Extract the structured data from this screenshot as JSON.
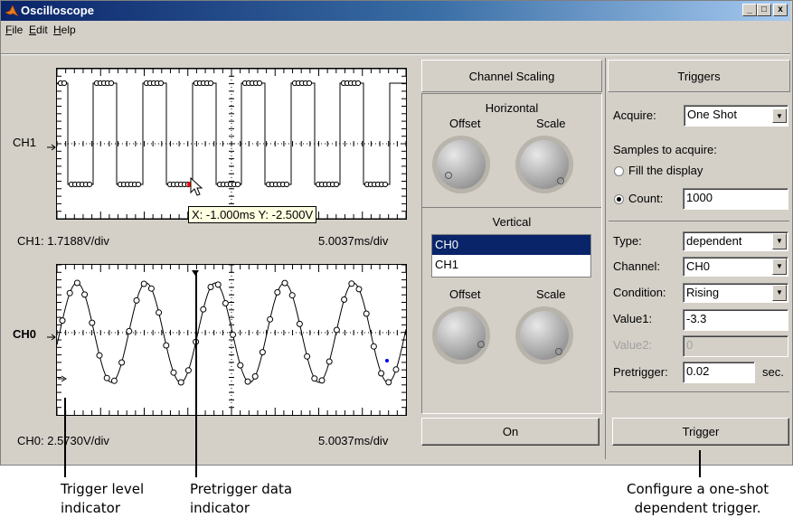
{
  "window": {
    "title": "Oscilloscope",
    "controls": [
      "_",
      "□",
      "x"
    ]
  },
  "menu": [
    {
      "label": "File",
      "accel": "F",
      "rest": "ile"
    },
    {
      "label": "Edit",
      "accel": "E",
      "rest": "dit"
    },
    {
      "label": "Help",
      "accel": "H",
      "rest": "elp"
    }
  ],
  "scope": {
    "top": {
      "channel_label": "CH1",
      "scale_left": "CH1: 1.7188V/div",
      "scale_right": "5.0037ms/div",
      "tooltip": "X: -1.000ms Y: -2.500V"
    },
    "bottom": {
      "channel_label": "CH0",
      "scale_left": "CH0: 2.5730V/div",
      "scale_right": "5.0037ms/div"
    }
  },
  "channel_scaling": {
    "header": "Channel Scaling",
    "horizontal_label": "Horizontal",
    "offset_label": "Offset",
    "scale_label": "Scale",
    "vertical_label": "Vertical",
    "channels": [
      "CH0",
      "CH1"
    ],
    "selected_channel": "CH0",
    "vertical_offset_label": "Offset",
    "vertical_scale_label": "Scale",
    "on_button": "On"
  },
  "triggers": {
    "header": "Triggers",
    "acquire_label": "Acquire:",
    "acquire_value": "One Shot",
    "samples_label": "Samples to acquire:",
    "fill_label": "Fill the display",
    "count_label": "Count:",
    "count_value": "1000",
    "type_label": "Type:",
    "type_value": "dependent",
    "channel_label": "Channel:",
    "channel_value": "CH0",
    "condition_label": "Condition:",
    "condition_value": "Rising",
    "value1_label": "Value1:",
    "value1_value": "-3.3",
    "value2_label": "Value2:",
    "value2_value": "0",
    "pretrigger_label": "Pretrigger:",
    "pretrigger_value": "0.02",
    "pretrigger_unit": "sec.",
    "trigger_button": "Trigger"
  },
  "annotations": {
    "trigger_level": [
      "Trigger level",
      "indicator"
    ],
    "pretrigger": [
      "Pretrigger data",
      "indicator"
    ],
    "configure": [
      "Configure a one-shot",
      "dependent trigger."
    ]
  },
  "colors": {
    "title_start": "#0a246a",
    "title_end": "#a6caf0",
    "selection": "#0a246a",
    "cursor_marker": "#ff0000",
    "trigger_marker": "#0000ff"
  }
}
